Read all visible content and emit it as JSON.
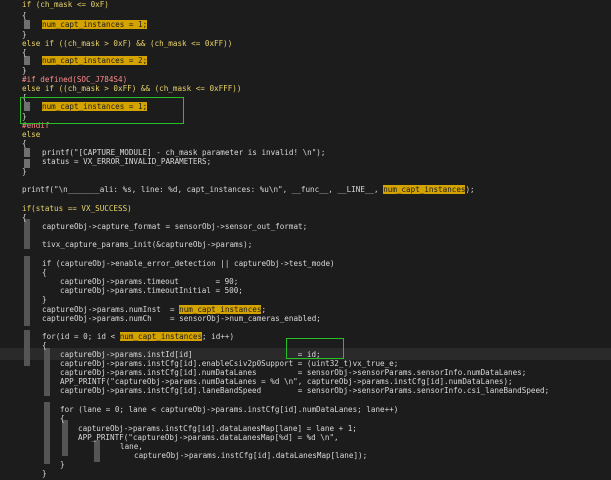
{
  "editor": {
    "lines": [
      {
        "id": "l0",
        "text": "if (ch_mask <= 0xF)"
      },
      {
        "id": "l1",
        "text": "{"
      },
      {
        "id": "l2",
        "text": "num_capt_instances = 1;"
      },
      {
        "id": "l3",
        "text": "}"
      },
      {
        "id": "l4",
        "text": "else if ((ch_mask > 0xF) && (ch_mask <= 0xFF))"
      },
      {
        "id": "l5",
        "text": "{"
      },
      {
        "id": "l6",
        "text": "num_capt_instances = 2;"
      },
      {
        "id": "l7",
        "text": "}"
      },
      {
        "id": "l8",
        "text": "#if defined(SOC_J784S4)"
      },
      {
        "id": "l9",
        "text": "else if ((ch_mask > 0xFF) && (ch_mask <= 0xFFF))"
      },
      {
        "id": "l10",
        "text": "{"
      },
      {
        "id": "l11",
        "text": "num_capt_instances = 1;"
      },
      {
        "id": "l12",
        "text": "}"
      },
      {
        "id": "l13",
        "text": "#endif"
      },
      {
        "id": "l14",
        "text": "else"
      },
      {
        "id": "l15",
        "text": "{"
      },
      {
        "id": "l16",
        "text": "printf(\"[CAPTURE_MODULE] - ch_mask parameter is invalid! \\n\");"
      },
      {
        "id": "l17",
        "text": "status = VX_ERROR_INVALID_PARAMETERS;"
      },
      {
        "id": "l18",
        "text": "}"
      },
      {
        "id": "l19",
        "text": "printf(\"\\n_______ali: %s, line: %d, capt_instances: %u\\n\", __func__, __LINE__, num_capt_instances);"
      },
      {
        "id": "l20",
        "text": "if(status == VX_SUCCESS)"
      },
      {
        "id": "l21",
        "text": "{"
      },
      {
        "id": "l22",
        "text": "captureObj->capture_format = sensorObj->sensor_out_format;"
      },
      {
        "id": "l23",
        "text": "tivx_capture_params_init(&captureObj->params);"
      },
      {
        "id": "l24",
        "text": "if (captureObj->enable_error_detection || captureObj->test_mode)"
      },
      {
        "id": "l25",
        "text": "{"
      },
      {
        "id": "l26",
        "text": "captureObj->params.timeout        = 90;"
      },
      {
        "id": "l27",
        "text": "captureObj->params.timeoutInitial = 500;"
      },
      {
        "id": "l28",
        "text": "}"
      },
      {
        "id": "l29",
        "text": "captureObj->params.numInst  = num_capt_instances;"
      },
      {
        "id": "l30",
        "text": "captureObj->params.numCh    = sensorObj->num_cameras_enabled;"
      },
      {
        "id": "l31",
        "text": "for(id = 0; id < num_capt_instances; id++)"
      },
      {
        "id": "l32",
        "text": "{"
      },
      {
        "id": "l33",
        "text": "captureObj->params.instId[id]                       = id;"
      },
      {
        "id": "l34",
        "text": "captureObj->params.instCfg[id].enableCsiv2p0Support = (uint32_t)vx_true_e;"
      },
      {
        "id": "l35",
        "text": "captureObj->params.instCfg[id].numDataLanes         = sensorObj->sensorParams.sensorInfo.numDataLanes;"
      },
      {
        "id": "l36",
        "text": "APP_PRINTF(\"captureObj->params.numDataLanes = %d \\n\", captureObj->params.instCfg[id].numDataLanes);"
      },
      {
        "id": "l37",
        "text": "captureObj->params.instCfg[id].laneBandSpeed        = sensorObj->sensorParams.sensorInfo.csi_laneBandSpeed;"
      },
      {
        "id": "l38",
        "text": "for (lane = 0; lane < captureObj->params.instCfg[id].numDataLanes; lane++)"
      },
      {
        "id": "l39",
        "text": "{"
      },
      {
        "id": "l40",
        "text": "captureObj->params.instCfg[id].dataLanesMap[lane] = lane + 1;"
      },
      {
        "id": "l41",
        "text": "APP_PRINTF(\"captureObj->params.dataLanesMap[%d] = %d \\n\","
      },
      {
        "id": "l42",
        "text": "lane,"
      },
      {
        "id": "l43",
        "text": "captureObj->params.instCfg[id].dataLanesMap[lane]);"
      },
      {
        "id": "l44",
        "text": "}"
      },
      {
        "id": "l45",
        "text": "}"
      }
    ],
    "search_term": "num_capt_instances",
    "colors": {
      "background": "#1c1c1c",
      "text": "#d8d8d8",
      "keyword": "#e8d36a",
      "number": "#4fb4ff",
      "string": "#ff5fd7",
      "preprocessor": "#ff8c8c",
      "search_highlight": "#d4a300",
      "cursor": "#30d0d0",
      "annotation_box": "#25c025"
    }
  }
}
